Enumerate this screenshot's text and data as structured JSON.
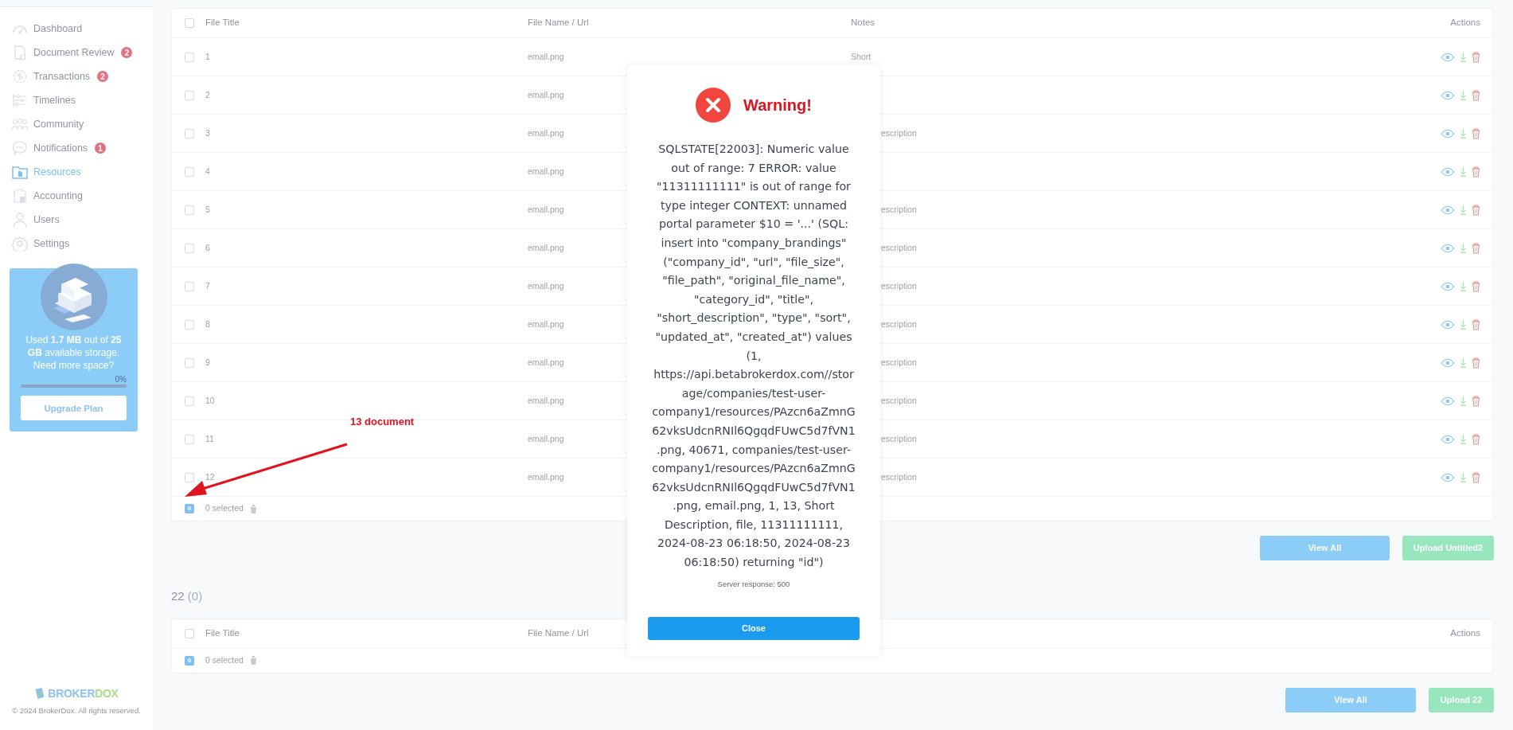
{
  "sidebar": {
    "items": [
      {
        "label": "Dashboard",
        "selected": false
      },
      {
        "label": "Document Review",
        "badge": "2",
        "selected": false
      },
      {
        "label": "Transactions",
        "badge": "2",
        "selected": false
      },
      {
        "label": "Timelines",
        "selected": false
      },
      {
        "label": "Community",
        "selected": false
      },
      {
        "label": "Notifications",
        "badge": "1",
        "selected": false
      },
      {
        "label": "Resources",
        "selected": true
      },
      {
        "label": "Accounting",
        "selected": false
      },
      {
        "label": "Users",
        "selected": false
      },
      {
        "label": "Settings",
        "selected": false
      }
    ],
    "storage": {
      "text": "Used **1.7 MB** out of **25 GB** available storage. Need more space?",
      "percent": "0%",
      "level": 0,
      "button": "Upgrade Plan"
    },
    "brand": {
      "part_1": "BROKER",
      "part_2": "DOX"
    },
    "copyright": "© 2024 BrokerDox. All rights reserved."
  },
  "sections": [
    {
      "columns": [
        {
          "kind": "title",
          "label": "File Title"
        },
        {
          "kind": "file",
          "label": "File Name / Url"
        },
        {
          "kind": "notes",
          "label": "Notes"
        },
        {
          "kind": "actions",
          "label": "Actions"
        }
      ],
      "header_checked": false,
      "rows": [
        {
          "title": "1",
          "file": "email.png",
          "notes": "Short",
          "checked": false
        },
        {
          "title": "2",
          "file": "email.png",
          "checked": false
        },
        {
          "title": "3",
          "file": "email.png",
          "notes": "escription",
          "notes_cut": true,
          "checked": false
        },
        {
          "title": "4",
          "file": "email.png",
          "checked": false
        },
        {
          "title": "5",
          "file": "email.png",
          "notes": "escription",
          "notes_cut": true,
          "checked": false
        },
        {
          "title": "6",
          "file": "email.png",
          "notes": "escription",
          "notes_cut": true,
          "checked": false
        },
        {
          "title": "7",
          "file": "email.png",
          "notes": "escription",
          "notes_cut": true,
          "checked": false
        },
        {
          "title": "8",
          "file": "email.png",
          "notes": "escription",
          "notes_cut": true,
          "checked": false
        },
        {
          "title": "9",
          "file": "email.png",
          "notes": "escription",
          "notes_cut": true,
          "checked": false
        },
        {
          "title": "10",
          "file": "email.png",
          "notes": "escription",
          "notes_cut": true,
          "checked": false
        },
        {
          "title": "11",
          "file": "email.png",
          "notes": "escription",
          "notes_cut": true,
          "checked": false
        },
        {
          "title": "12",
          "file": "email.png",
          "notes": "escription",
          "notes_cut": true,
          "checked": false
        }
      ],
      "footer": {
        "count": "0",
        "selected_text": "0 selected"
      },
      "buttons": [
        {
          "kind": "view",
          "label": "View All"
        },
        {
          "kind": "upload",
          "label": "Upload Untitled2"
        }
      ]
    },
    {
      "title": "22",
      "count": "(0)",
      "columns": [
        {
          "kind": "title",
          "label": "File Title"
        },
        {
          "kind": "file",
          "label": "File Name / Url"
        },
        {
          "kind": "actions",
          "label": "Actions"
        }
      ],
      "header_checked": false,
      "footer": {
        "count": "0",
        "selected_text": "0 selected"
      },
      "buttons": [
        {
          "kind": "view",
          "label": "View All"
        },
        {
          "kind": "upload",
          "label": "Upload 22"
        }
      ]
    }
  ],
  "annotation": {
    "text": "13 document"
  },
  "modal": {
    "title": "Warning!",
    "message": "SQLSTATE[22003]: Numeric value out of range: 7 ERROR: value \"11311111111\" is out of range for type integer CONTEXT: unnamed portal parameter $10 = '...' (SQL: insert into \"company_brandings\" (\"company_id\", \"url\", \"file_size\", \"file_path\", \"original_file_name\", \"category_id\", \"title\", \"short_description\", \"type\", \"sort\", \"updated_at\", \"created_at\") values (1, https://api.betabrokerdox.com//storage/companies/test-user-company1/resources/PAzcn6aZmnG62vksUdcnRNIl6QgqdFUwC5d7fVN1.png, 40671, companies/test-user-company1/resources/PAzcn6aZmnG62vksUdcnRNIl6QgqdFUwC5d7fVN1.png, email.png, 1, 13, Short Description, file, 11311111111, 2024-08-23 06:18:50, 2024-08-23 06:18:50) returning \"id\")",
    "server_response": "Server response: 500",
    "button": "Close"
  }
}
